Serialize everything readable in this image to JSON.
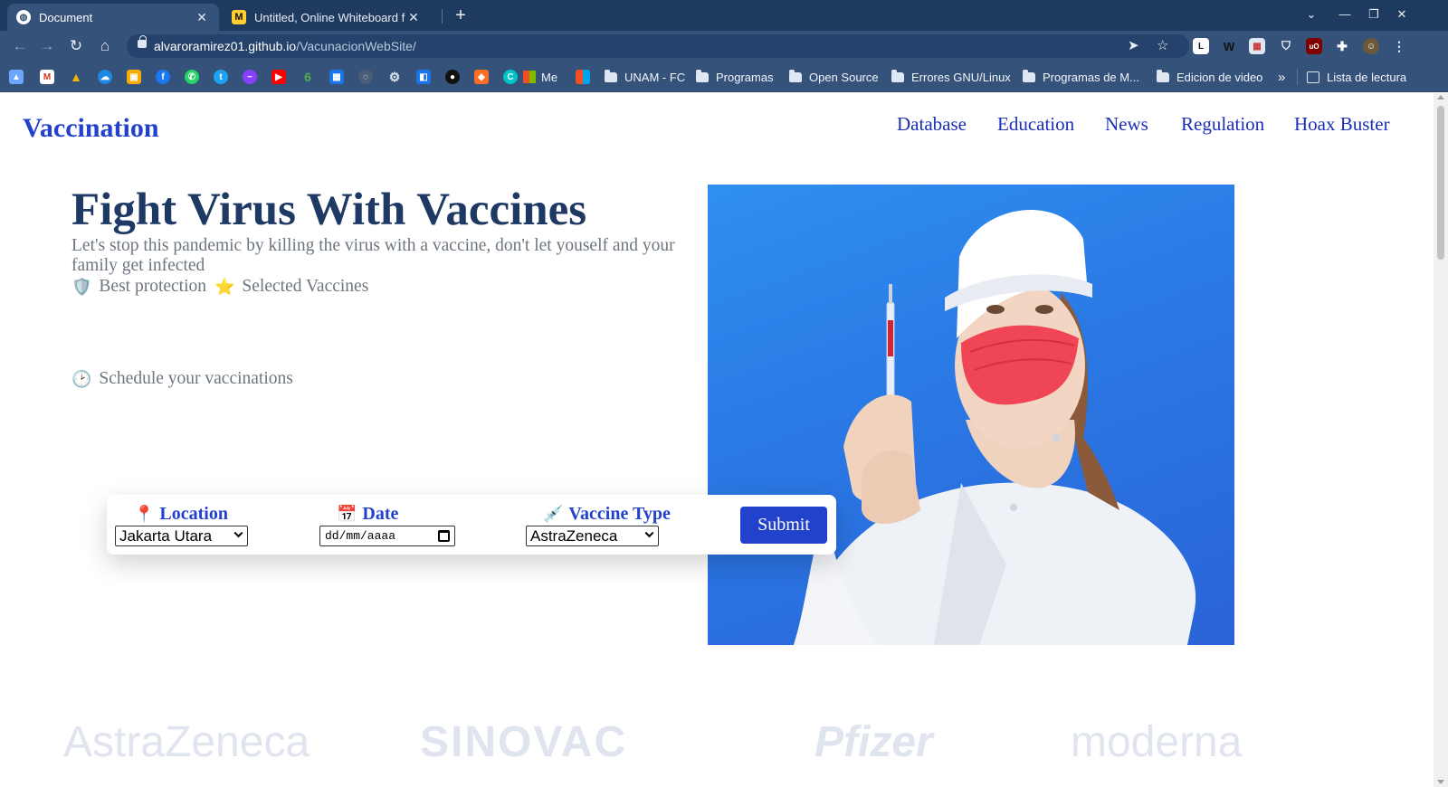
{
  "browser": {
    "tabs": [
      {
        "title": "Document",
        "active": true
      },
      {
        "title": "Untitled, Online Whiteboard f",
        "active": false
      }
    ],
    "url_host": "alvaroramirez01.github.io",
    "url_path": "/VacunacionWebSite/",
    "bookmarks": {
      "me": "Me",
      "folders": [
        "UNAM - FC",
        "Programas",
        "Open Source",
        "Errores GNU/Linux",
        "Programas de M...",
        "Edicion de video"
      ],
      "more": "»",
      "reading_list": "Lista de lectura"
    },
    "colors": {
      "frame": "#1f3a5f",
      "toolbar": "#35527b",
      "omnibox": "#24426b"
    }
  },
  "site": {
    "brand": "Vaccination",
    "nav": [
      "Database",
      "Education",
      "News",
      "Regulation",
      "Hoax Buster"
    ],
    "colors": {
      "brand": "#2241cc",
      "title": "#1f3965",
      "muted": "#6d7680",
      "photo_bg": "#2a78e4"
    }
  },
  "hero": {
    "title": "Fight Virus With Vaccines",
    "subtitle": "Let's stop this pandemic by killing the virus with a vaccine, don't let youself and your family get infected",
    "features": [
      {
        "icon": "🛡️",
        "label": "Best protection"
      },
      {
        "icon": "⭐",
        "label": "Selected Vaccines"
      }
    ],
    "schedule": {
      "icon": "🕑",
      "label": "Schedule your vaccinations"
    }
  },
  "booking": {
    "location": {
      "icon": "📍",
      "label": "Location",
      "value": "Jakarta Utara"
    },
    "date": {
      "icon": "📅",
      "label": "Date",
      "placeholder": "dd/mm/aaaa"
    },
    "vaccine": {
      "icon": "💉",
      "label": "Vaccine Type",
      "value": "AstraZeneca"
    },
    "submit": "Submit"
  },
  "partners": [
    "AstraZeneca",
    "SINOVAC",
    "Pfizer",
    "moderna"
  ]
}
